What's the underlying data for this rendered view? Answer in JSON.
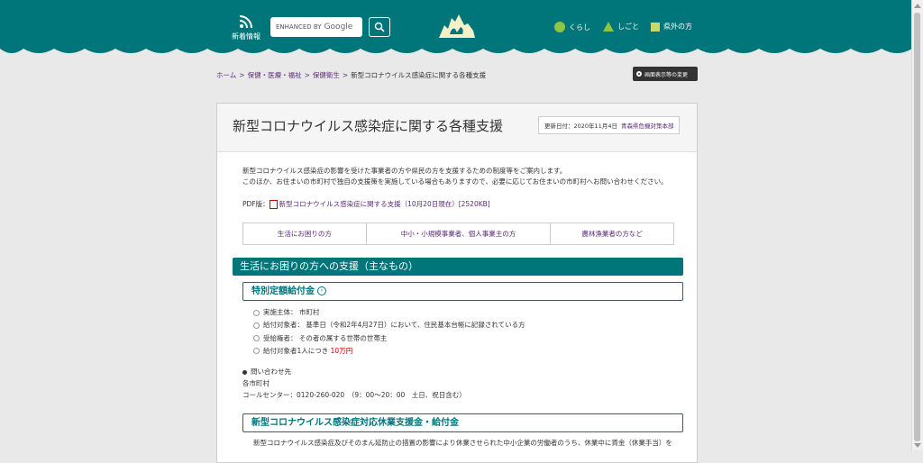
{
  "header": {
    "bg_color": "#00757a",
    "news_label": "新着情報",
    "search": {
      "enhanced_label": "ENHANCED BY",
      "google_label": "Google"
    },
    "nav": [
      {
        "label": "くらし",
        "icon": "circle-icon",
        "color": "#8dc63f"
      },
      {
        "label": "しごと",
        "icon": "triangle-icon",
        "color": "#8dc63f"
      },
      {
        "label": "県外の方",
        "icon": "square-icon",
        "color": "#c8d96f"
      }
    ]
  },
  "breadcrumb": {
    "items": [
      "ホーム",
      "保健・医療・福祉",
      "保健衛生"
    ],
    "current": "新型コロナウイルス感染症に関する各種支援"
  },
  "display_button": "画面表示等の変更",
  "article": {
    "title": "新型コロナウイルス感染症に関する各種支援",
    "updated_label": "更新日付：2020年11月4日",
    "updated_office": "青森県危機対策本部",
    "intro_1": "新型コロナウイルス感染症の影響を受けた事業者の方や県民の方を支援するための制度等をご案内します。",
    "intro_2": "このほか、お住まいの市町村で独自の支援策を実施している場合もありますので、必要に応じてお住まいの市町村へお問い合わせください。",
    "pdf_prefix": "PDF版：",
    "pdf_link": "新型コロナウイルス感染症に関する支援（10月20日現在）[2520KB]",
    "tabs": [
      "生活にお困りの方",
      "中小・小規模事業者、個人事業主の方",
      "農林漁業者の方など"
    ],
    "section_heading": "生活にお困りの方への支援（主なもの）",
    "sub1": {
      "heading": "特別定額給付金",
      "items": [
        {
          "text": "実施主体：  市町村"
        },
        {
          "text": "給付対象者：  基準日（令和2年4月27日）において、住民基本台帳に記録されている方"
        },
        {
          "text": "受給権者：  その者の属する世帯の世帯主"
        },
        {
          "text": "給付対象者1人につき ",
          "highlight": "10万円"
        }
      ],
      "inquiry_label": "問い合わせ先",
      "inquiry_org": "各市町村",
      "inquiry_call": "コールセンター：0120-260-020　（9：00～20：00　土日、祝日含む）"
    },
    "sub2": {
      "heading": "新型コロナウイルス感染症対応休業支援金・給付金",
      "text": "新型コロナウイルス感染症及びそのまん延防止の措置の影響により休業させられた中小企業の労働者のうち、休業中に賃金（休業手当）を"
    }
  }
}
